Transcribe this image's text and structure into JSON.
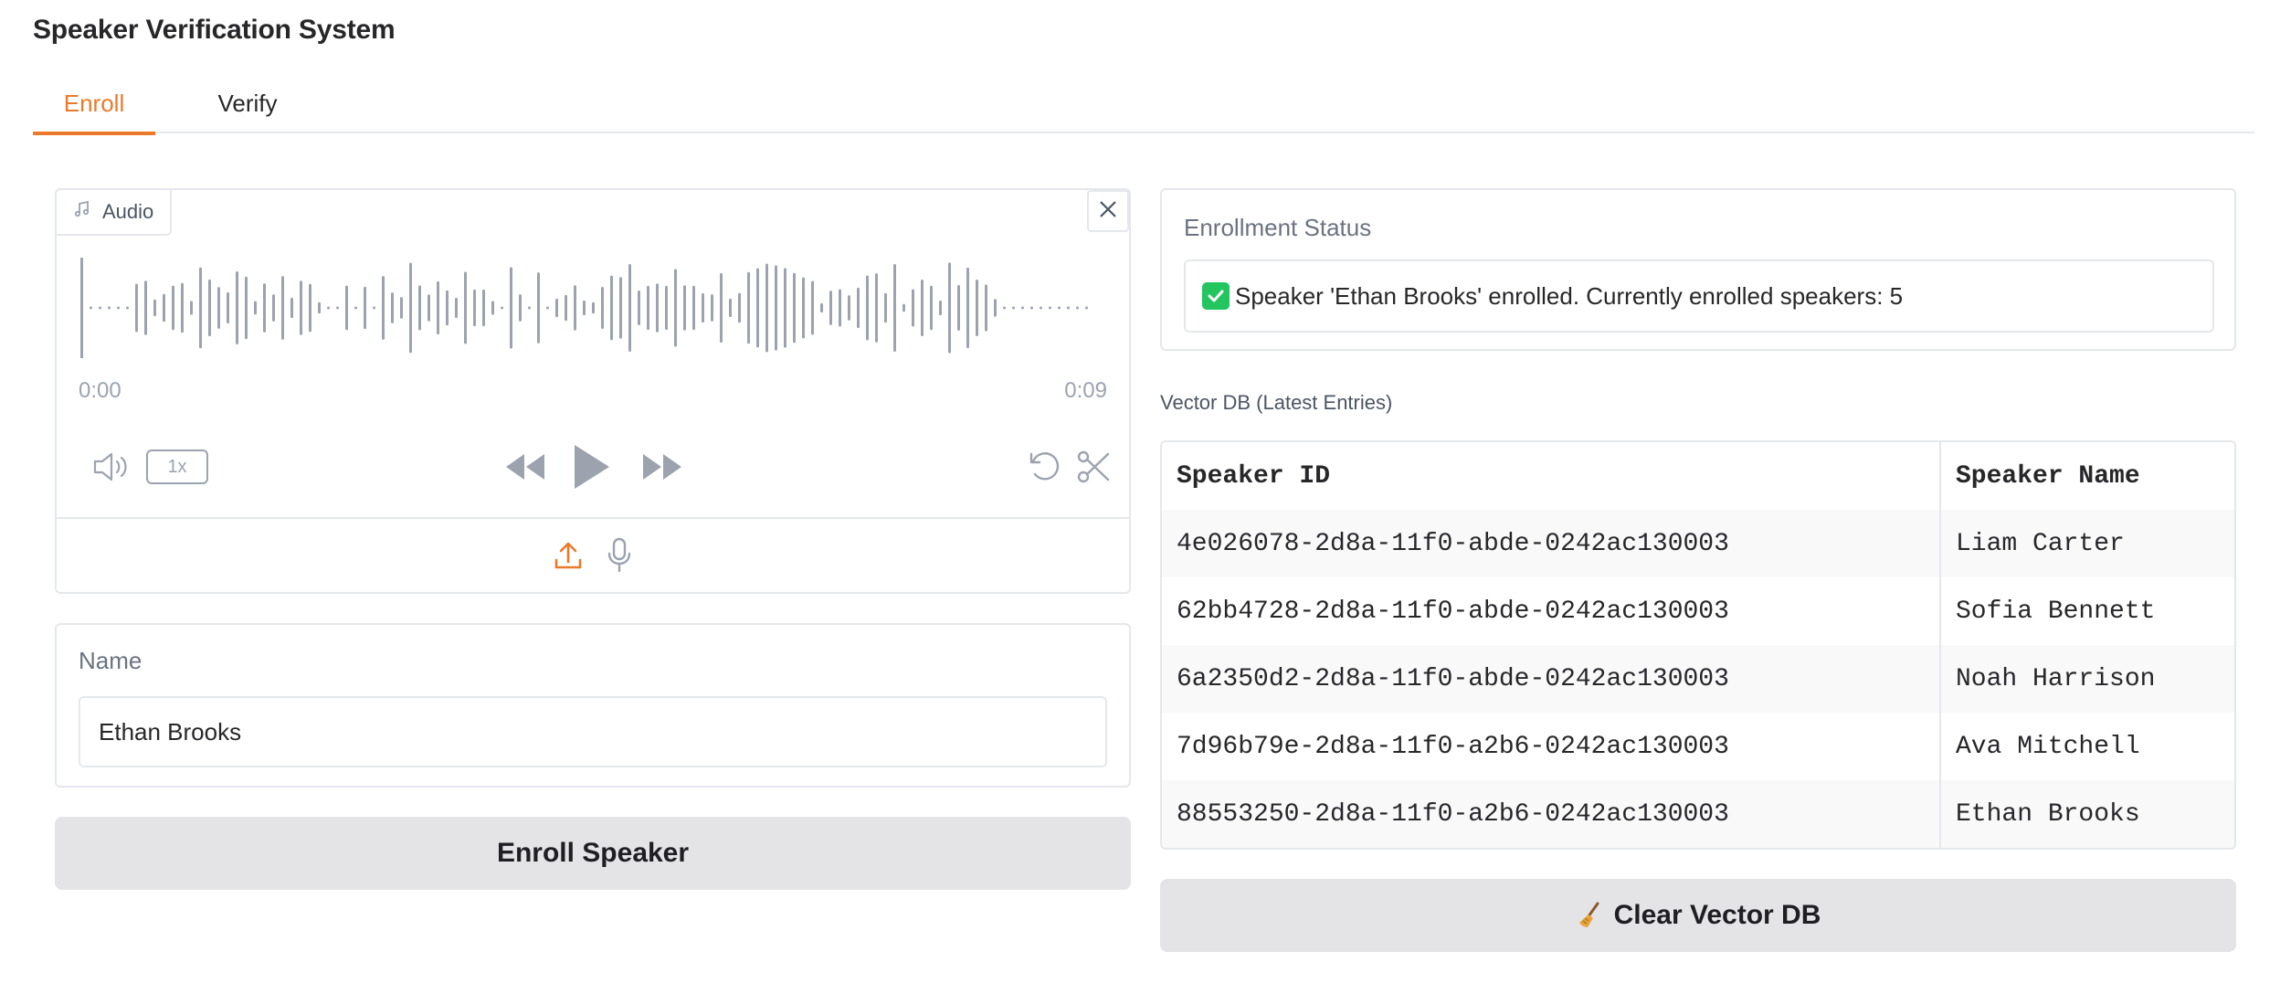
{
  "app": {
    "title": "Speaker Verification System"
  },
  "tabs": [
    {
      "label": "Enroll",
      "active": true
    },
    {
      "label": "Verify",
      "active": false
    }
  ],
  "audio": {
    "label": "Audio",
    "time_start": "0:00",
    "time_end": "0:09",
    "speed": "1x",
    "icons": [
      "music-note-icon",
      "close-icon",
      "volume-icon",
      "rewind-icon",
      "play-icon",
      "fast-forward-icon",
      "undo-icon",
      "scissors-icon",
      "upload-icon",
      "microphone-icon"
    ]
  },
  "name_field": {
    "label": "Name",
    "value": "Ethan Brooks"
  },
  "enroll_button": {
    "label": "Enroll Speaker"
  },
  "status": {
    "label": "Enrollment Status",
    "message": "Speaker 'Ethan Brooks' enrolled. Currently enrolled speakers: 5"
  },
  "vector_db": {
    "label": "Vector DB (Latest Entries)",
    "columns": [
      "Speaker ID",
      "Speaker Name"
    ],
    "rows": [
      [
        "4e026078-2d8a-11f0-abde-0242ac130003",
        "Liam Carter"
      ],
      [
        "62bb4728-2d8a-11f0-abde-0242ac130003",
        "Sofia Bennett"
      ],
      [
        "6a2350d2-2d8a-11f0-abde-0242ac130003",
        "Noah Harrison"
      ],
      [
        "7d96b79e-2d8a-11f0-a2b6-0242ac130003",
        "Ava Mitchell"
      ],
      [
        "88553250-2d8a-11f0-a2b6-0242ac130003",
        "Ethan Brooks"
      ]
    ]
  },
  "clear_button": {
    "label": "Clear Vector DB"
  },
  "colors": {
    "accent": "#ea7a2a",
    "success": "#22c55e",
    "button_bg": "#e4e4e7",
    "border": "#e5e7eb"
  }
}
